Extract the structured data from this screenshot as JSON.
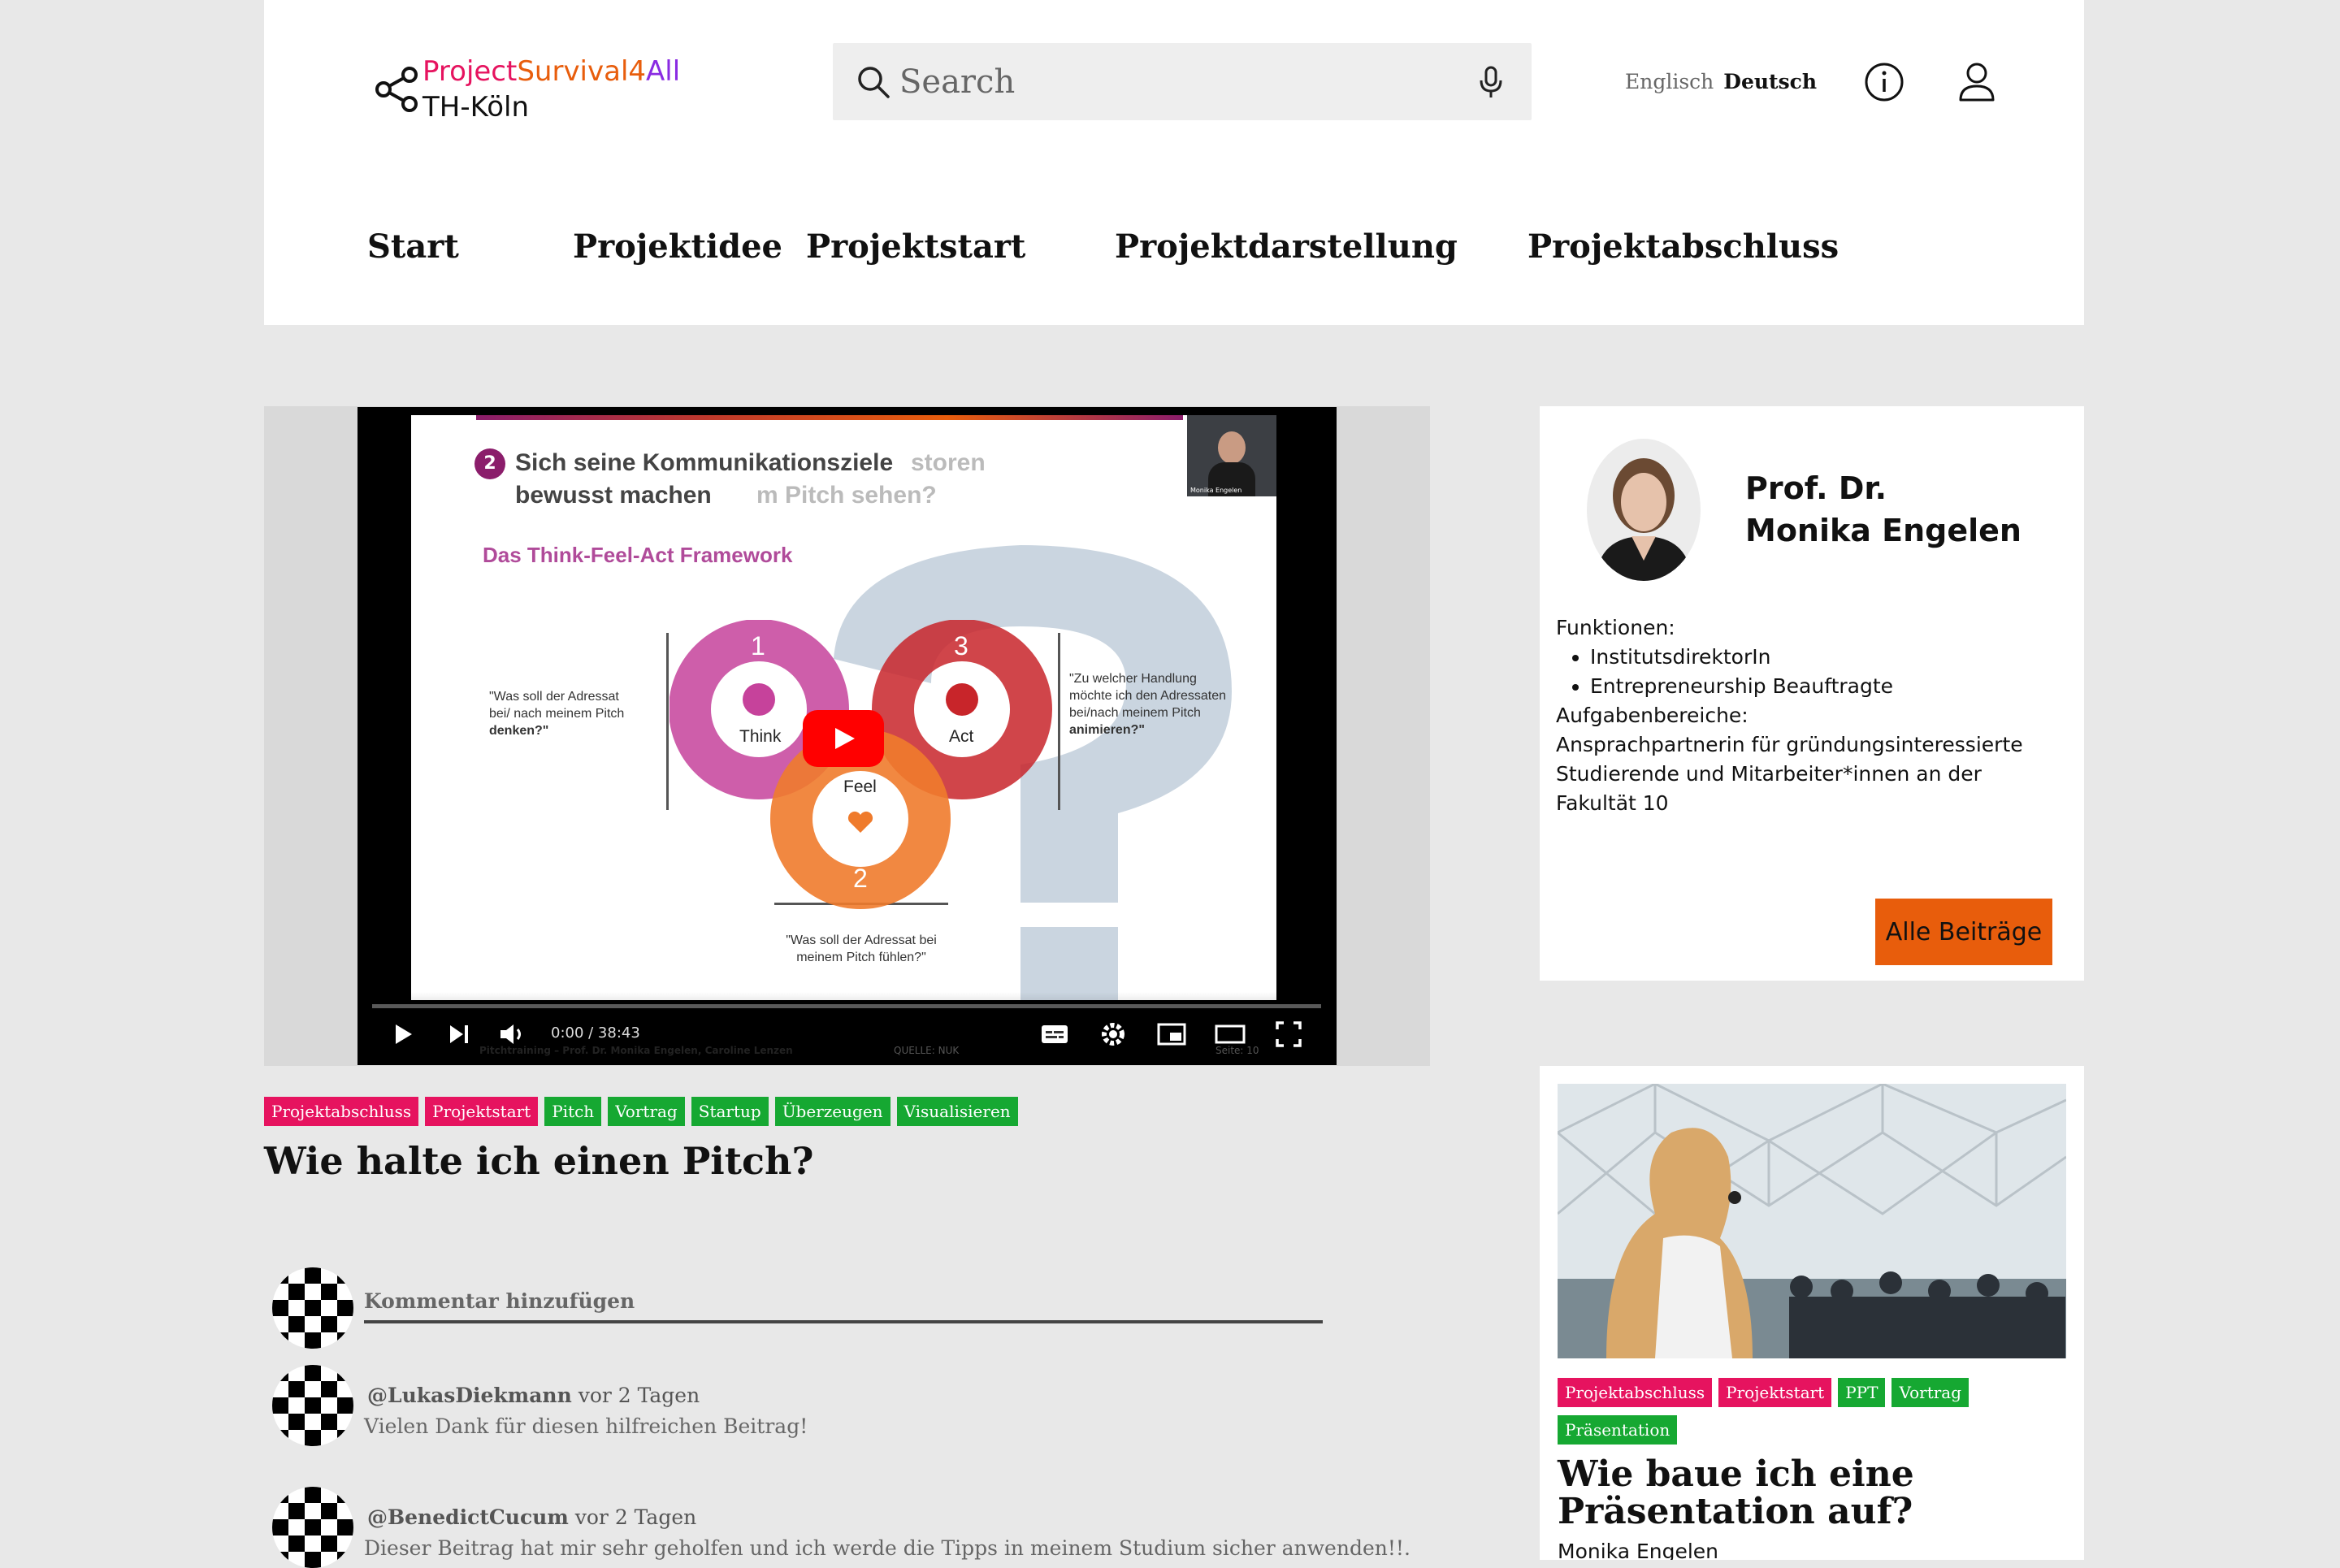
{
  "brand": {
    "line1_part1": "Project",
    "line1_part2": "Survival4",
    "line1_part3": "All",
    "line2": "TH-Köln",
    "colors": {
      "project": "#e6135f",
      "survival": "#e85d0c",
      "all": "#8a2be2"
    }
  },
  "search": {
    "placeholder": "Search"
  },
  "language": {
    "english": "Englisch",
    "german": "Deutsch"
  },
  "icons": {
    "info": "info-icon",
    "user": "user-icon",
    "search": "search-icon",
    "mic": "microphone-icon",
    "logo": "share-icon"
  },
  "nav": [
    {
      "label": "Start"
    },
    {
      "label": "Projektidee"
    },
    {
      "label": "Projektstart"
    },
    {
      "label": "Projektdarstellung"
    },
    {
      "label": "Projektabschluss"
    }
  ],
  "video": {
    "time": "0:00 / 38:43",
    "slide": {
      "number": "2",
      "title_line1": "Sich seine Kommunikationsziele",
      "title_line2": "bewusst machen",
      "ghost_line1": "storen",
      "ghost_line2": "m Pitch sehen?",
      "subtitle": "Das Think-Feel-Act Framework",
      "think": "Think",
      "feel": "Feel",
      "act": "Act",
      "n1": "1",
      "n2": "2",
      "n3": "3",
      "q_think_1": "\"Was soll der Adressat",
      "q_think_2": "bei/ nach meinem Pitch",
      "q_think_3": "denken?\"",
      "q_act_1": "\"Zu welcher Handlung",
      "q_act_2": "möchte ich den Adressaten",
      "q_act_3": "bei/nach meinem Pitch",
      "q_act_4": "animieren?\"",
      "q_feel_1": "\"Was soll der Adressat bei",
      "q_feel_2": "meinem Pitch fühlen?\"",
      "footer": "Pitchtraining – Prof. Dr. Monika Engelen, Caroline Lenzen",
      "source": "QUELLE: NUK",
      "page": "Seite: 10",
      "cam_label": "Monika Engelen"
    }
  },
  "main_tags": [
    {
      "label": "Projektabschluss",
      "color": "pink"
    },
    {
      "label": "Projektstart",
      "color": "pink"
    },
    {
      "label": "Pitch",
      "color": "green"
    },
    {
      "label": "Vortrag",
      "color": "green"
    },
    {
      "label": "Startup",
      "color": "green"
    },
    {
      "label": "Überzeugen",
      "color": "green"
    },
    {
      "label": "Visualisieren",
      "color": "green"
    }
  ],
  "post": {
    "title": "Wie halte ich einen Pitch?"
  },
  "comments": {
    "placeholder": "Kommentar hinzufügen",
    "items": [
      {
        "user": "@LukasDiekmann",
        "time": "vor 2 Tagen",
        "text": "Vielen Dank für diesen hilfreichen Beitrag!"
      },
      {
        "user": "@BenedictCucum",
        "time": "vor 2 Tagen",
        "text": "Dieser Beitrag hat mir sehr geholfen und ich werde die Tipps in meinem Studium sicher anwenden!!."
      }
    ]
  },
  "author": {
    "name_line1": "Prof. Dr.",
    "name_line2": "Monika Engelen",
    "functions_label": "Funktionen:",
    "functions": [
      "InstitutsdirektorIn",
      "Entrepreneurship Beauftragte"
    ],
    "areas_label": "Aufgabenbereiche:",
    "areas_text": "Ansprachpartnerin für gründungsinteressierte Studierende und Mitarbeiter*innen an der Fakultät 10",
    "button": "Alle Beiträge",
    "button_color": "#e85d0c"
  },
  "related": {
    "tags": [
      {
        "label": "Projektabschluss",
        "color": "pink"
      },
      {
        "label": "Projektstart",
        "color": "pink"
      },
      {
        "label": "PPT",
        "color": "green"
      },
      {
        "label": "Vortrag",
        "color": "green"
      },
      {
        "label": "Präsentation",
        "color": "green"
      }
    ],
    "title": "Wie baue ich eine Präsentation auf?",
    "author": "Monika Engelen"
  }
}
